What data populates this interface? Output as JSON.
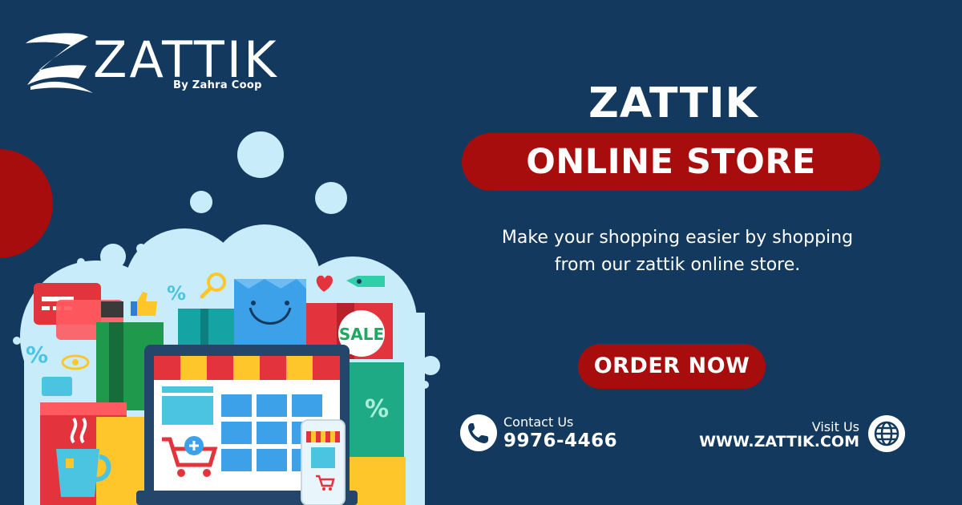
{
  "brand": {
    "logo_text": "ZATTIK",
    "logo_subtitle": "By Zahra Coop"
  },
  "hero": {
    "title": "ZATTIK",
    "subtitle": "ONLINE STORE",
    "tagline_line1": "Make your shopping easier by shopping",
    "tagline_line2": "from our zattik online store."
  },
  "cta": {
    "order_label": "ORDER NOW"
  },
  "contact": {
    "label": "Contact Us",
    "phone": "9976-4466"
  },
  "website": {
    "label": "Visit Us",
    "url": "WWW.ZATTIK.COM"
  },
  "illustration": {
    "sale_tag": "SALE"
  },
  "colors": {
    "background": "#133a5e",
    "accent_red": "#a80d0d",
    "light_blue": "#c9ecfa",
    "text": "#ffffff"
  }
}
